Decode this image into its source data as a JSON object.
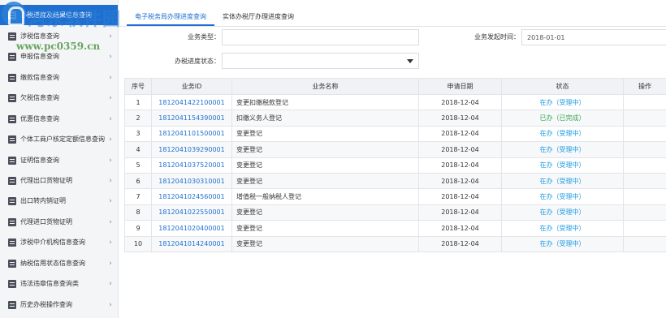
{
  "sidebar": {
    "items": [
      {
        "label": "办税进度及结果信息查询",
        "icon": "progress-icon",
        "active": true
      },
      {
        "label": "涉税信息查询",
        "icon": "document-icon"
      },
      {
        "label": "申报信息查询",
        "icon": "declare-icon"
      },
      {
        "label": "缴款信息查询",
        "icon": "payment-icon"
      },
      {
        "label": "欠税信息查询",
        "icon": "arrears-icon"
      },
      {
        "label": "优惠信息查询",
        "icon": "discount-icon"
      },
      {
        "label": "个体工商户核定定额信息查询",
        "icon": "business-icon"
      },
      {
        "label": "证明信息查询",
        "icon": "certificate-icon"
      },
      {
        "label": "代理出口货物证明",
        "icon": "export-icon"
      },
      {
        "label": "出口转内销证明",
        "icon": "domestic-sale-icon"
      },
      {
        "label": "代理进口货物证明",
        "icon": "import-icon"
      },
      {
        "label": "涉税中介机构信息查询",
        "icon": "agency-icon"
      },
      {
        "label": "纳税信用状态信息查询",
        "icon": "credit-icon"
      },
      {
        "label": "违法违章信息查询类",
        "icon": "violation-icon"
      },
      {
        "label": "历史办税操作查询",
        "icon": "history-icon"
      }
    ]
  },
  "watermark": {
    "title": "河东软件园",
    "url": "www.pc0359.cn"
  },
  "tabs": [
    {
      "label": "电子税务局办理进度查询",
      "active": true
    },
    {
      "label": "实体办税厅办理进度查询",
      "active": false
    }
  ],
  "filters": {
    "business_type_label": "业务类型：",
    "business_type_value": "",
    "start_time_label": "业务发起时间：",
    "start_time_value": "2018-01-01",
    "status_label": "办税进度状态：",
    "status_value": ""
  },
  "table": {
    "headers": [
      "序号",
      "业务ID",
      "业务名称",
      "申请日期",
      "状态",
      "操作"
    ],
    "rows": [
      [
        "1",
        "1812041422100001",
        "变更扣缴税款登记",
        "2018-12-04",
        "在办（受理中）",
        ""
      ],
      [
        "2",
        "1812041154390001",
        "扣缴义务人登记",
        "2018-12-04",
        "已办（已完成）",
        ""
      ],
      [
        "3",
        "1812041101500001",
        "变更登记",
        "2018-12-04",
        "在办（受理中）",
        ""
      ],
      [
        "4",
        "1812041039290001",
        "变更登记",
        "2018-12-04",
        "在办（受理中）",
        ""
      ],
      [
        "5",
        "1812041037520001",
        "变更登记",
        "2018-12-04",
        "在办（受理中）",
        ""
      ],
      [
        "6",
        "1812041030310001",
        "变更登记",
        "2018-12-04",
        "在办（受理中）",
        ""
      ],
      [
        "7",
        "1812041024560001",
        "增值税一般纳税人登记",
        "2018-12-04",
        "在办（受理中）",
        ""
      ],
      [
        "8",
        "1812041022550001",
        "变更登记",
        "2018-12-04",
        "在办（受理中）",
        ""
      ],
      [
        "9",
        "1812041020400001",
        "变更登记",
        "2018-12-04",
        "在办（受理中）",
        ""
      ],
      [
        "10",
        "1812041014240001",
        "变更登记",
        "2018-12-04",
        "在办（受理中）",
        ""
      ]
    ]
  },
  "colors": {
    "accent": "#1f6fd1",
    "status_pending": "#1f9be0",
    "status_done": "#33a853"
  }
}
